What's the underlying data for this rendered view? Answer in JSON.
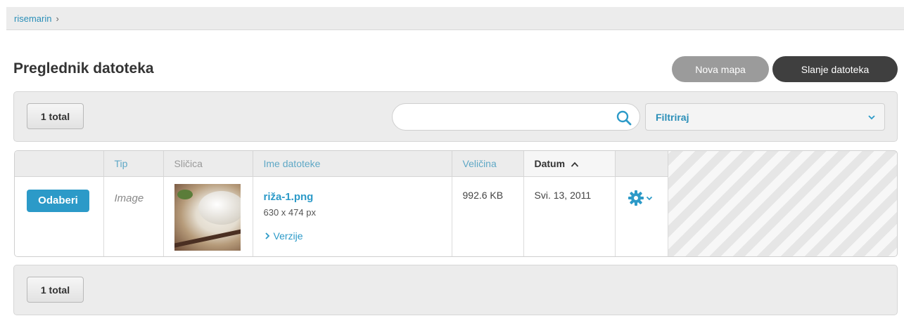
{
  "breadcrumb": {
    "items": [
      "risemarin"
    ],
    "separator": "›"
  },
  "page": {
    "title": "Preglednik datoteka"
  },
  "actions": {
    "new_folder": "Nova mapa",
    "upload": "Slanje datoteka"
  },
  "toolbar": {
    "total_label": "1 total",
    "search": {
      "value": "",
      "placeholder": ""
    },
    "filter": {
      "selected": "Filtriraj"
    }
  },
  "table": {
    "columns": {
      "type": "Tip",
      "thumbnail": "Sličica",
      "filename": "Ime datoteke",
      "size": "Veličina",
      "date": "Datum"
    },
    "sort": {
      "column": "date",
      "direction": "ascending"
    },
    "rows": [
      {
        "select_label": "Odaberi",
        "type": "Image",
        "filename": "riža-1.png",
        "dimensions": "630 x 474 px",
        "versions_label": "Verzije",
        "size": "992.6 KB",
        "date": "Svi. 13, 2011"
      }
    ]
  },
  "footer": {
    "total_label": "1 total"
  },
  "colors": {
    "accent": "#2c9ac8",
    "header_bg": "#ececec",
    "dark_button": "#3f3f3f",
    "gray_button": "#9b9b9b"
  },
  "icons": [
    "search-icon",
    "chevron-down-icon",
    "chevron-up-icon",
    "chevron-right-icon",
    "gear-icon"
  ]
}
